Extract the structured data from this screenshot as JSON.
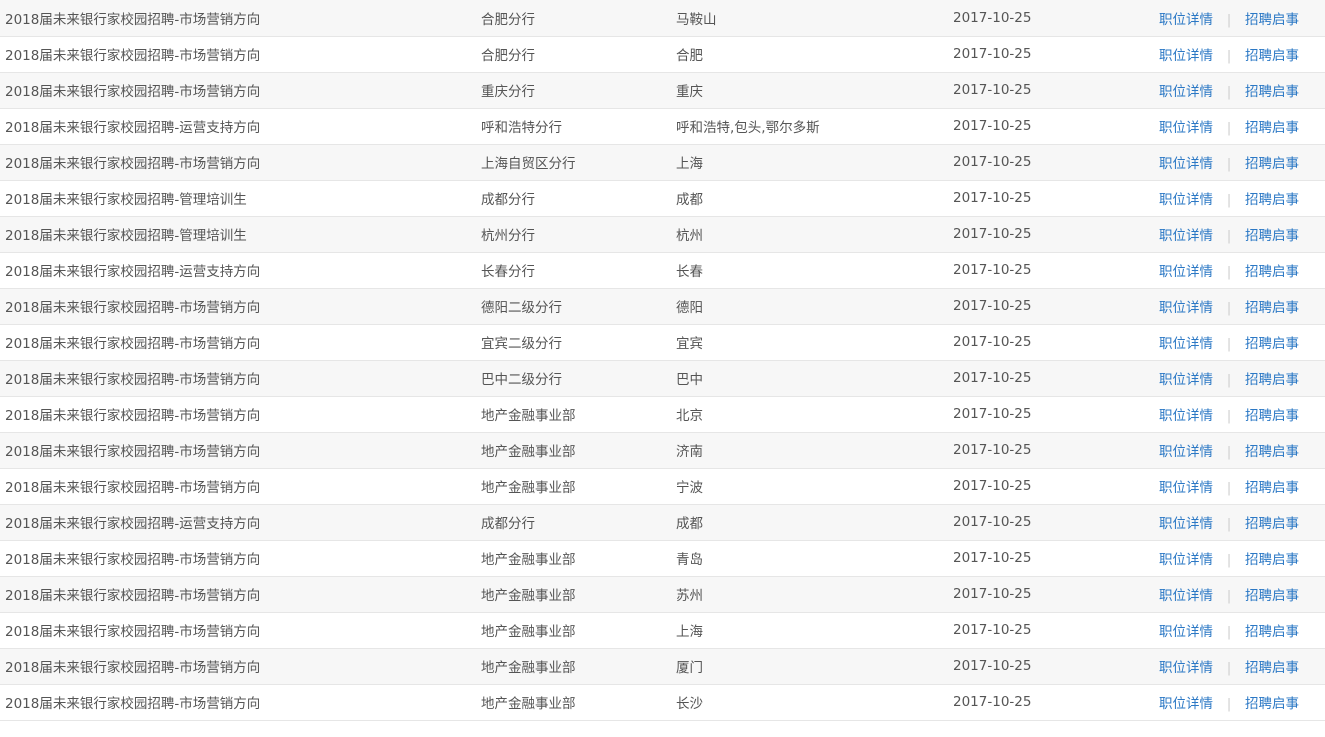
{
  "actions": {
    "details_label": "职位详情",
    "notice_label": "招聘启事",
    "separator": "|"
  },
  "rows": [
    {
      "title": "2018届未来银行家校园招聘-市场营销方向",
      "branch": "合肥分行",
      "city": "马鞍山",
      "date": "2017-10-25"
    },
    {
      "title": "2018届未来银行家校园招聘-市场营销方向",
      "branch": "合肥分行",
      "city": "合肥",
      "date": "2017-10-25"
    },
    {
      "title": "2018届未来银行家校园招聘-市场营销方向",
      "branch": "重庆分行",
      "city": "重庆",
      "date": "2017-10-25"
    },
    {
      "title": "2018届未来银行家校园招聘-运营支持方向",
      "branch": "呼和浩特分行",
      "city": "呼和浩特,包头,鄂尔多斯",
      "date": "2017-10-25"
    },
    {
      "title": "2018届未来银行家校园招聘-市场营销方向",
      "branch": "上海自贸区分行",
      "city": "上海",
      "date": "2017-10-25"
    },
    {
      "title": "2018届未来银行家校园招聘-管理培训生",
      "branch": "成都分行",
      "city": "成都",
      "date": "2017-10-25"
    },
    {
      "title": "2018届未来银行家校园招聘-管理培训生",
      "branch": "杭州分行",
      "city": "杭州",
      "date": "2017-10-25"
    },
    {
      "title": "2018届未来银行家校园招聘-运营支持方向",
      "branch": "长春分行",
      "city": "长春",
      "date": "2017-10-25"
    },
    {
      "title": "2018届未来银行家校园招聘-市场营销方向",
      "branch": "德阳二级分行",
      "city": "德阳",
      "date": "2017-10-25"
    },
    {
      "title": "2018届未来银行家校园招聘-市场营销方向",
      "branch": "宜宾二级分行",
      "city": "宜宾",
      "date": "2017-10-25"
    },
    {
      "title": "2018届未来银行家校园招聘-市场营销方向",
      "branch": "巴中二级分行",
      "city": "巴中",
      "date": "2017-10-25"
    },
    {
      "title": "2018届未来银行家校园招聘-市场营销方向",
      "branch": "地产金融事业部",
      "city": "北京",
      "date": "2017-10-25"
    },
    {
      "title": "2018届未来银行家校园招聘-市场营销方向",
      "branch": "地产金融事业部",
      "city": "济南",
      "date": "2017-10-25"
    },
    {
      "title": "2018届未来银行家校园招聘-市场营销方向",
      "branch": "地产金融事业部",
      "city": "宁波",
      "date": "2017-10-25"
    },
    {
      "title": "2018届未来银行家校园招聘-运营支持方向",
      "branch": "成都分行",
      "city": "成都",
      "date": "2017-10-25"
    },
    {
      "title": "2018届未来银行家校园招聘-市场营销方向",
      "branch": "地产金融事业部",
      "city": "青岛",
      "date": "2017-10-25"
    },
    {
      "title": "2018届未来银行家校园招聘-市场营销方向",
      "branch": "地产金融事业部",
      "city": "苏州",
      "date": "2017-10-25"
    },
    {
      "title": "2018届未来银行家校园招聘-市场营销方向",
      "branch": "地产金融事业部",
      "city": "上海",
      "date": "2017-10-25"
    },
    {
      "title": "2018届未来银行家校园招聘-市场营销方向",
      "branch": "地产金融事业部",
      "city": "厦门",
      "date": "2017-10-25"
    },
    {
      "title": "2018届未来银行家校园招聘-市场营销方向",
      "branch": "地产金融事业部",
      "city": "长沙",
      "date": "2017-10-25"
    }
  ]
}
